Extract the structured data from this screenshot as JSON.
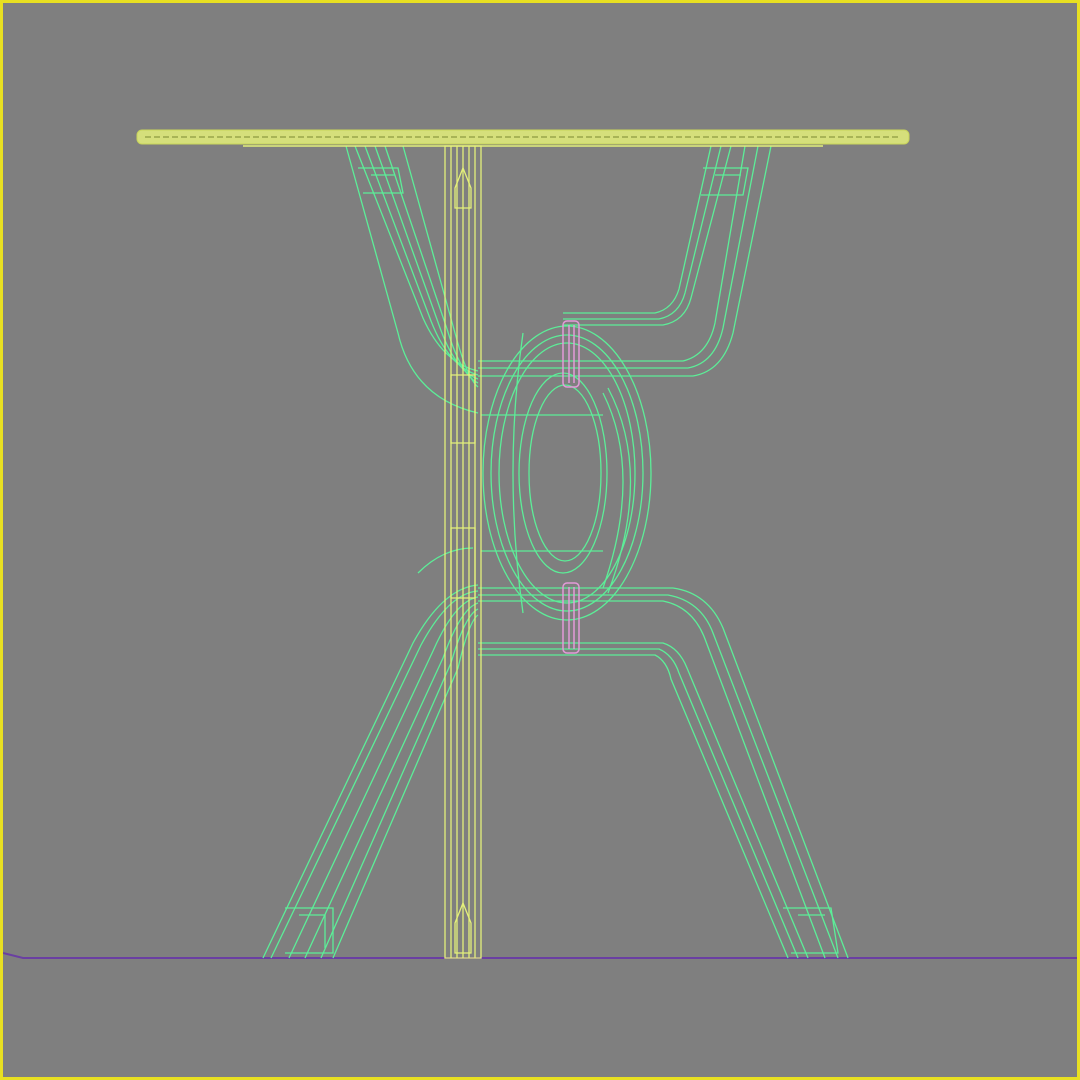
{
  "viewport": {
    "background": "#7f7f7f",
    "active_border_color": "#e8e021"
  },
  "scene": {
    "colors": {
      "selected": "#e4f07a",
      "legs": "#5cee98",
      "pins": "#e39ad8",
      "ground": "#6a3fa2"
    },
    "objects": [
      "tabletop",
      "center-post",
      "leg-upper-left",
      "leg-upper-right",
      "leg-lower-left",
      "leg-lower-right",
      "ring-connector",
      "pin-top",
      "pin-bottom",
      "ground-line"
    ]
  }
}
